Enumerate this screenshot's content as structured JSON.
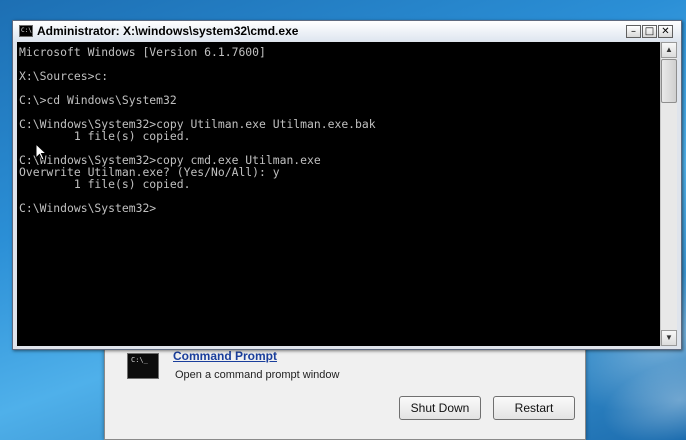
{
  "window": {
    "title": "Administrator: X:\\windows\\system32\\cmd.exe",
    "minimize": "–",
    "maximize": "□",
    "close": "✕"
  },
  "console": {
    "lines": [
      "Microsoft Windows [Version 6.1.7600]",
      "",
      "X:\\Sources>c:",
      "",
      "C:\\>cd Windows\\System32",
      "",
      "C:\\Windows\\System32>copy Utilman.exe Utilman.exe.bak",
      "        1 file(s) copied.",
      "",
      "C:\\Windows\\System32>copy cmd.exe Utilman.exe",
      "Overwrite Utilman.exe? (Yes/No/All): y",
      "        1 file(s) copied.",
      "",
      "C:\\Windows\\System32>"
    ]
  },
  "recovery": {
    "tool_icon_text": "C:\\_",
    "tool_link": "Command Prompt",
    "tool_desc": "Open a command prompt window",
    "shutdown_label": "Shut Down",
    "restart_label": "Restart"
  },
  "icons": {
    "scroll_up": "▲",
    "scroll_down": "▼",
    "cmd_icon_text": "C:\\"
  }
}
